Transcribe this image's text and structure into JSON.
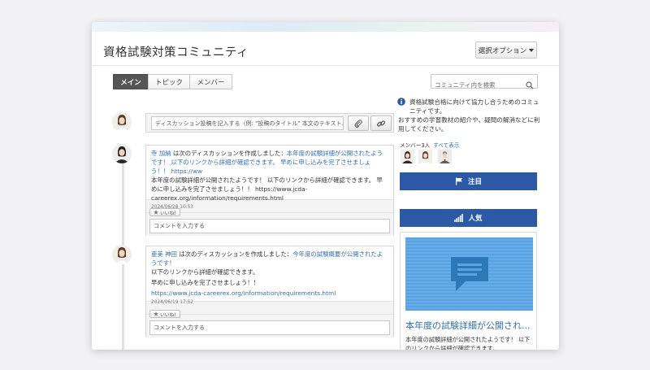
{
  "page": {
    "title": "資格試験対策コミュニティ",
    "options_label": "選択オプション"
  },
  "tabs": [
    {
      "label": "メイン",
      "active": true
    },
    {
      "label": "トピック",
      "active": false
    },
    {
      "label": "メンバー",
      "active": false
    }
  ],
  "search": {
    "placeholder": "コミュニティ内を検索"
  },
  "composer": {
    "placeholder": "ディスカッション投稿を記入する（例: \"投稿のタイトル\" 本文のテキスト...)"
  },
  "posts": [
    {
      "author": "寺 加納",
      "action": " は次のディスカッションを作成しました：",
      "headline": "本年度の試験詳細が公開されたようです！ 以下のリンクから詳細が確認できます。 早めに申し込みを完了させましょう！！ https://ww",
      "body": "本年度の試験詳細が公開されたようです！ 以下のリンクから詳細が確認できます。 早めに申し込みを完了させましょう！！ https://www.jcda-careerex.org/information/requirements.html",
      "timestamp": "2024/06/28 10:53",
      "like_label": "いいね!",
      "comment_placeholder": "コメントを入力する"
    },
    {
      "author": "亜美 神田",
      "action": " は次のディスカッションを作成しました：",
      "headline": "今年度の試験概要が公開されたようです！",
      "body1": "以下のリンクから詳細が確認できます。",
      "body2": "早めに申し込みを完了させましょう！！",
      "link": "https://www.jcda-careerex.org/information/requirements.html",
      "timestamp": "2024/06/19 17:52",
      "like_label": "いいね!",
      "comment_placeholder": "コメントを入力する"
    }
  ],
  "sidebar": {
    "desc1": "資格試験合格に向けて協力し合うためのコミュニティです。",
    "desc2": "おすすめの学習教材の紹介や、疑問の解消などに利用してください。",
    "members_label": "メンバー3人",
    "show_all": "すべて表示",
    "attention_label": "注目",
    "popular_label": "人気",
    "card_title": "本年度の試験詳細が公開され...",
    "card_text": "本年度の試験詳細が公開されたようです！ 以下のリンクから詳細が確認できます。"
  },
  "colors": {
    "accent": "#2b59a6",
    "link": "#2f6fb5",
    "active_tab": "#555555"
  }
}
